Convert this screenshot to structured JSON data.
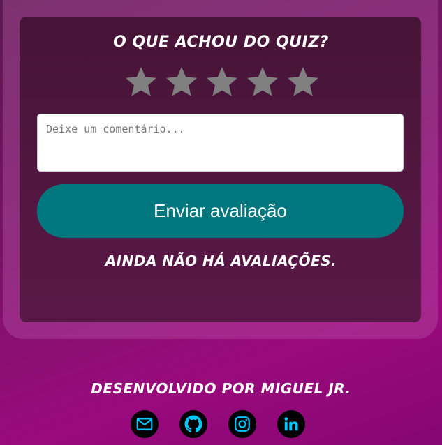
{
  "rating": {
    "title": "O que achou do quiz?",
    "stars_total": 5,
    "stars_selected": 0,
    "star_color": "#808080",
    "comment_placeholder": "Deixe um comentário...",
    "comment_value": "",
    "submit_label": "Enviar avaliação",
    "empty_message": "Ainda não há avaliações."
  },
  "footer": {
    "credits": "Desenvolvido por Miguel Jr.",
    "icon_color": "#00c8ff",
    "links": [
      {
        "icon": "email-icon"
      },
      {
        "icon": "github-icon"
      },
      {
        "icon": "instagram-icon"
      },
      {
        "icon": "linkedin-icon"
      }
    ]
  },
  "colors": {
    "button": "#00777f",
    "panel": "#4e163e",
    "background": "#7d136a"
  }
}
